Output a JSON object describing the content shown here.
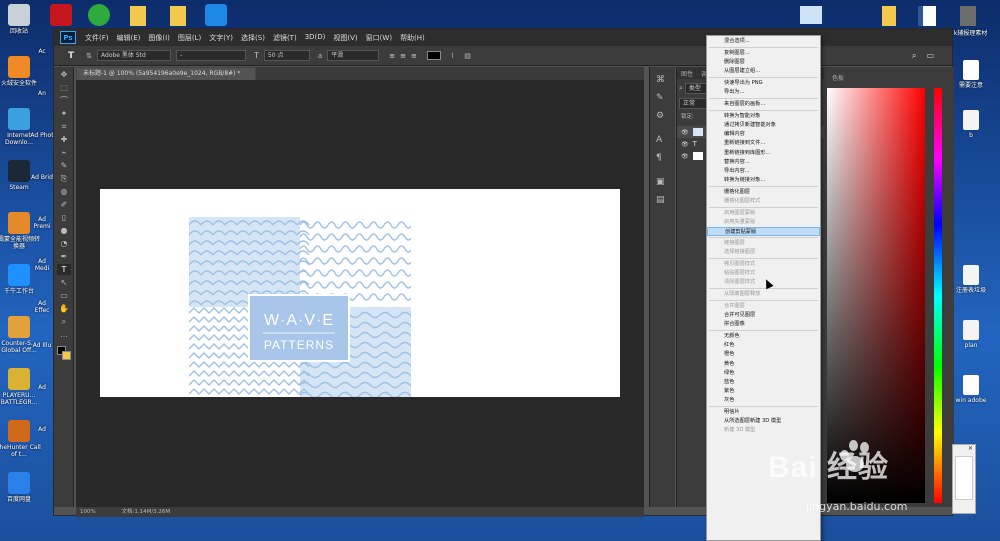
{
  "desktop_left": [
    {
      "label": "回收站",
      "color": "#c8d0d8"
    },
    {
      "label": "火绒安全软件",
      "color": "#f08a24"
    },
    {
      "label": "Internet Downlo...",
      "color": "#3aa0e0"
    },
    {
      "label": "Steam",
      "color": "#1b2838"
    },
    {
      "label": "霸蒙全能视频转换器",
      "color": "#e58a2a"
    },
    {
      "label": "千牛工作台",
      "color": "#1e90ff"
    },
    {
      "label": "Counter-S... Global Off...",
      "color": "#e2a13b"
    },
    {
      "label": "PLAYERU... BATTLEGR...",
      "color": "#d9b233"
    },
    {
      "label": "theHunter Call of t...",
      "color": "#d06a1a"
    },
    {
      "label": "百度网盘",
      "color": "#2a7fe8"
    }
  ],
  "desktop_col2": [
    "Ac",
    "An",
    "Ad Phot",
    "Ad Brid",
    "Ad Premi",
    "Ad Medi",
    "Ad Effec",
    "Ad Illu",
    "Ad",
    "Ad"
  ],
  "desktop_right": [
    "b",
    "注册表垃圾",
    "plan",
    "win adobe",
    "需要注意"
  ],
  "desktop_top_right": [
    "1k辅报理素材"
  ],
  "ps": {
    "logo": "Ps",
    "menu": [
      "文件(F)",
      "编辑(E)",
      "图像(I)",
      "图层(L)",
      "文字(Y)",
      "选择(S)",
      "滤镜(T)",
      "3D(D)",
      "视图(V)",
      "窗口(W)",
      "帮助(H)"
    ],
    "font_family": "Adobe 黑体 Std",
    "font_style": "-",
    "font_size": "50 点",
    "antialias": "平滑",
    "doc_tab": "未标题-1 @ 100% (5a954196a0e9e_1024, RGB/8#) *",
    "status_zoom": "100%",
    "status_doc": "文档:1.14M/3.26M",
    "layer_panel_tabs": [
      "图性",
      "调整"
    ],
    "layer_filter": "类型",
    "layer_mode": "正常",
    "layer_lock": "锁定:",
    "color_panel_tab": "色板",
    "art_title": "W·A·V·E",
    "art_subtitle": "PATTERNS"
  },
  "context_menu": [
    {
      "label": "混合选项...",
      "disabled": false
    },
    {
      "sep": true
    },
    {
      "label": "复制图层...",
      "disabled": false
    },
    {
      "label": "删除图层",
      "disabled": false
    },
    {
      "label": "从图层建立组...",
      "disabled": false
    },
    {
      "sep": true
    },
    {
      "label": "快速导出为 PNG",
      "disabled": false
    },
    {
      "label": "导出为...",
      "disabled": false
    },
    {
      "sep": true
    },
    {
      "label": "来自图层的画板...",
      "disabled": false
    },
    {
      "sep": true
    },
    {
      "label": "转换为智能对象",
      "disabled": false
    },
    {
      "label": "通过拷贝新建智能对象",
      "disabled": false
    },
    {
      "label": "编辑内容",
      "disabled": false
    },
    {
      "label": "重新链接到文件...",
      "disabled": false
    },
    {
      "label": "重新链接到库图形...",
      "disabled": false
    },
    {
      "label": "替换内容...",
      "disabled": false
    },
    {
      "label": "导出内容...",
      "disabled": false
    },
    {
      "label": "转换为链接对象...",
      "disabled": false
    },
    {
      "sep": true
    },
    {
      "label": "栅格化图层",
      "disabled": false
    },
    {
      "label": "栅格化图层样式",
      "disabled": true
    },
    {
      "sep": true
    },
    {
      "label": "启用图层蒙版",
      "disabled": true
    },
    {
      "label": "启用矢量蒙版",
      "disabled": true
    },
    {
      "label": "创建剪贴蒙版",
      "disabled": false,
      "highlight": true
    },
    {
      "sep": true
    },
    {
      "label": "链接图层",
      "disabled": true
    },
    {
      "label": "选择链接图层",
      "disabled": true
    },
    {
      "sep": true
    },
    {
      "label": "拷贝图层样式",
      "disabled": true
    },
    {
      "label": "粘贴图层样式",
      "disabled": true
    },
    {
      "label": "清除图层样式",
      "disabled": true
    },
    {
      "sep": true
    },
    {
      "label": "从隔离图层释放",
      "disabled": true
    },
    {
      "sep": true
    },
    {
      "label": "合并图层",
      "disabled": true
    },
    {
      "label": "合并可见图层",
      "disabled": false
    },
    {
      "label": "拼合图像",
      "disabled": false
    },
    {
      "sep": true
    },
    {
      "label": "无颜色",
      "disabled": false
    },
    {
      "label": "红色",
      "disabled": false
    },
    {
      "label": "橙色",
      "disabled": false
    },
    {
      "label": "黄色",
      "disabled": false
    },
    {
      "label": "绿色",
      "disabled": false
    },
    {
      "label": "蓝色",
      "disabled": false
    },
    {
      "label": "紫色",
      "disabled": false
    },
    {
      "label": "灰色",
      "disabled": false
    },
    {
      "sep": true
    },
    {
      "label": "明信片",
      "disabled": false
    },
    {
      "label": "从所选图层新建 3D 模型",
      "disabled": false
    },
    {
      "label": "新建 3D 模型",
      "disabled": true
    }
  ],
  "watermark": {
    "text": "Bai 经验",
    "url": "jingyan.baidu.com"
  },
  "colors": {
    "accent": "#31a8ff",
    "menu_highlight": "#bcdcf7",
    "pattern_blue": "#9fc1e6",
    "badge_blue": "#a9c6ea"
  }
}
